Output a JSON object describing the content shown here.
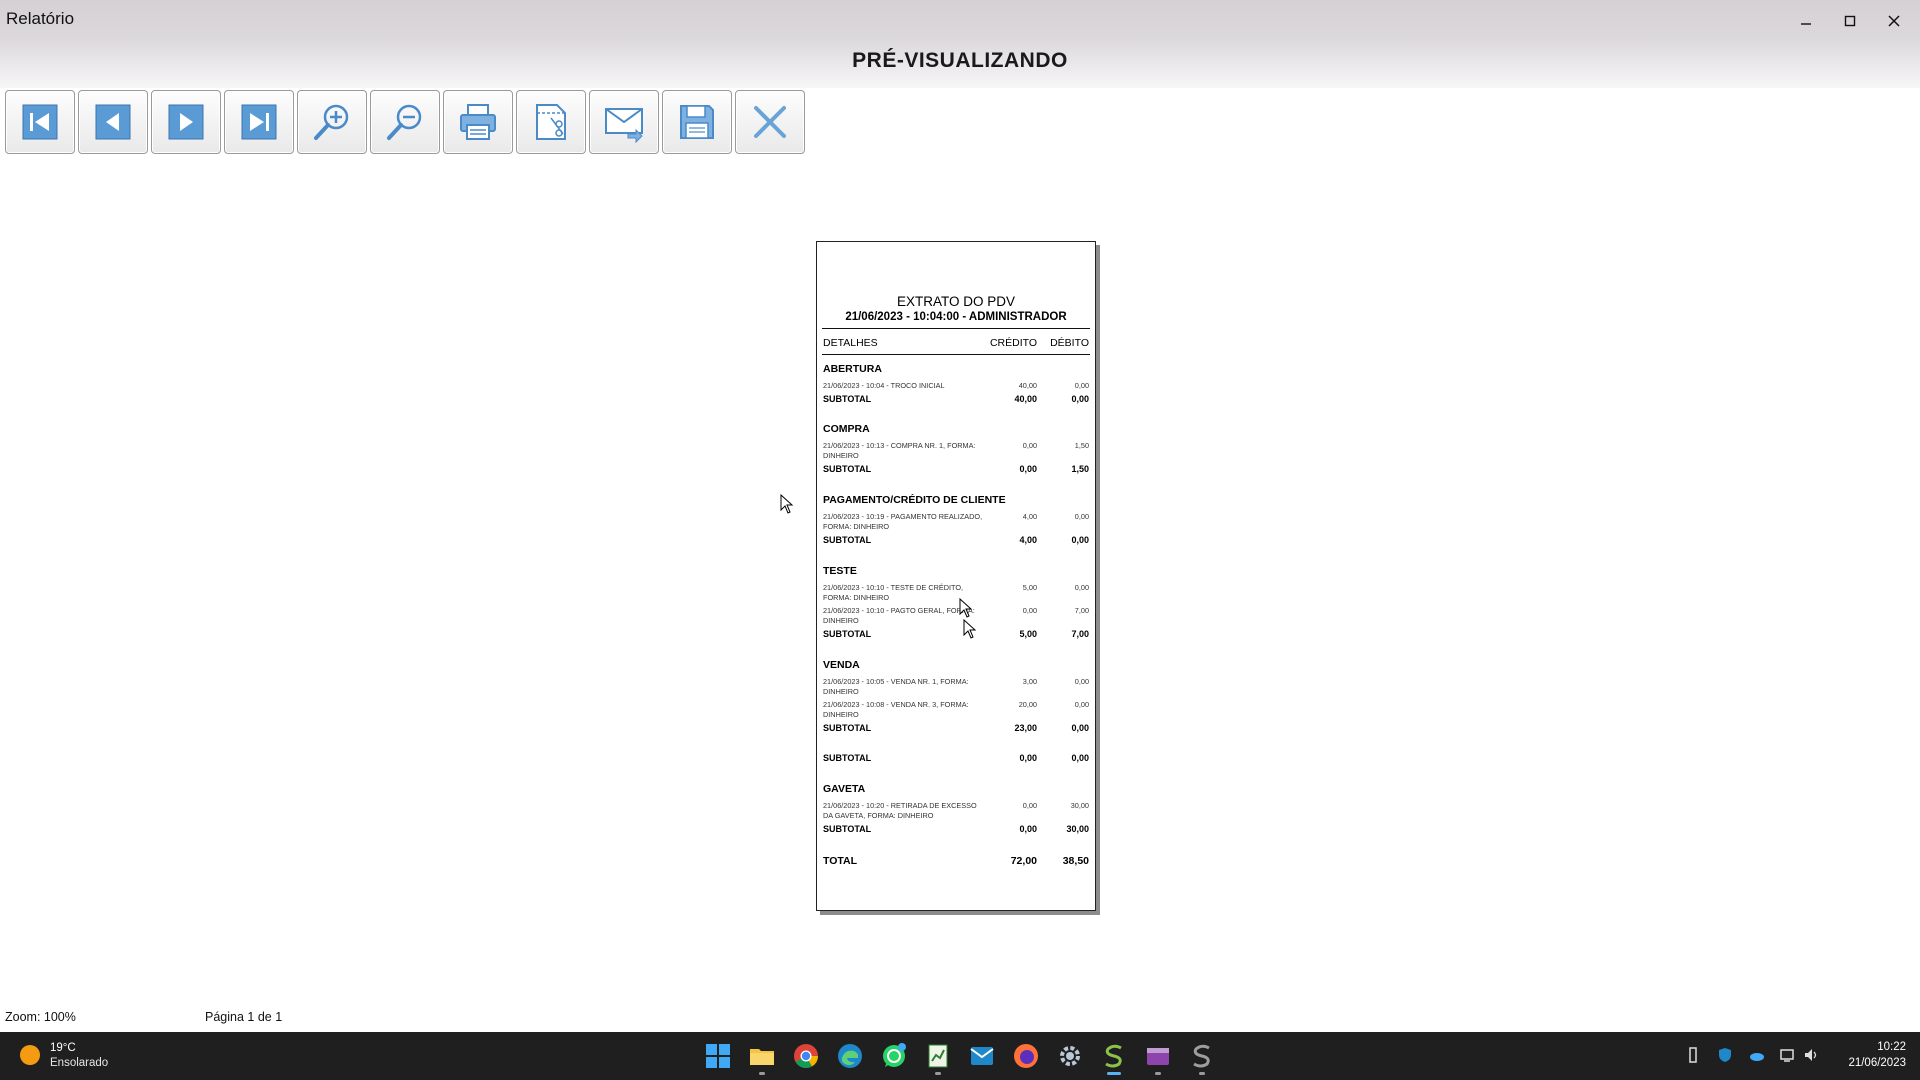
{
  "window": {
    "title": "Relatório",
    "header": "PRÉ-VISUALIZANDO"
  },
  "toolbar": {
    "buttons": [
      {
        "name": "first-page",
        "icon": "first-page-icon"
      },
      {
        "name": "previous-page",
        "icon": "previous-page-icon"
      },
      {
        "name": "next-page",
        "icon": "next-page-icon"
      },
      {
        "name": "last-page",
        "icon": "last-page-icon"
      },
      {
        "name": "zoom-in",
        "icon": "zoom-in-icon"
      },
      {
        "name": "zoom-out",
        "icon": "zoom-out-icon"
      },
      {
        "name": "print",
        "icon": "printer-icon"
      },
      {
        "name": "page-setup",
        "icon": "page-setup-icon"
      },
      {
        "name": "send-email",
        "icon": "email-icon"
      },
      {
        "name": "save",
        "icon": "save-icon"
      },
      {
        "name": "close",
        "icon": "close-icon"
      }
    ]
  },
  "report": {
    "title": "EXTRATO DO PDV",
    "subtitle": "21/06/2023 - 10:04:00 - ADMINISTRADOR",
    "columns": {
      "details": "DETALHES",
      "credit": "CRÉDITO",
      "debit": "DÉBITO"
    },
    "sections": [
      {
        "name": "ABERTURA",
        "entries": [
          {
            "desc": "21/06/2023 - 10:04 - TROCO INICIAL",
            "credit": "40,00",
            "debit": "0,00"
          }
        ],
        "subtotal": {
          "label": "SUBTOTAL",
          "credit": "40,00",
          "debit": "0,00"
        }
      },
      {
        "name": "COMPRA",
        "entries": [
          {
            "desc": "21/06/2023 - 10:13 - COMPRA NR. 1, FORMA: DINHEIRO",
            "credit": "0,00",
            "debit": "1,50"
          }
        ],
        "subtotal": {
          "label": "SUBTOTAL",
          "credit": "0,00",
          "debit": "1,50"
        }
      },
      {
        "name": "PAGAMENTO/CRÉDITO DE CLIENTE",
        "entries": [
          {
            "desc": "21/06/2023 - 10:19 - PAGAMENTO REALIZADO, FORMA: DINHEIRO",
            "credit": "4,00",
            "debit": "0,00"
          }
        ],
        "subtotal": {
          "label": "SUBTOTAL",
          "credit": "4,00",
          "debit": "0,00"
        }
      },
      {
        "name": "TESTE",
        "entries": [
          {
            "desc": "21/06/2023 - 10:10 - TESTE DE CRÉDITO, FORMA: DINHEIRO",
            "credit": "5,00",
            "debit": "0,00"
          },
          {
            "desc": "21/06/2023 - 10:10 - PAGTO GERAL, FORMA: DINHEIRO",
            "credit": "0,00",
            "debit": "7,00"
          }
        ],
        "subtotal": {
          "label": "SUBTOTAL",
          "credit": "5,00",
          "debit": "7,00"
        }
      },
      {
        "name": "VENDA",
        "entries": [
          {
            "desc": "21/06/2023 - 10:05 - VENDA NR. 1, FORMA: DINHEIRO",
            "credit": "3,00",
            "debit": "0,00"
          },
          {
            "desc": "21/06/2023 - 10:08 - VENDA NR. 3, FORMA: DINHEIRO",
            "credit": "20,00",
            "debit": "0,00"
          }
        ],
        "subtotal": {
          "label": "SUBTOTAL",
          "credit": "23,00",
          "debit": "0,00"
        }
      }
    ],
    "extra_subtotal": {
      "label": "SUBTOTAL",
      "credit": "0,00",
      "debit": "0,00"
    },
    "gaveta": {
      "name": "GAVETA",
      "entries": [
        {
          "desc": "21/06/2023 - 10:20 - RETIRADA DE EXCESSO DA GAVETA, FORMA: DINHEIRO",
          "credit": "0,00",
          "debit": "30,00"
        }
      ],
      "subtotal": {
        "label": "SUBTOTAL",
        "credit": "0,00",
        "debit": "30,00"
      }
    },
    "total": {
      "label": "TOTAL",
      "credit": "72,00",
      "debit": "38,50"
    }
  },
  "status": {
    "zoom": "Zoom: 100%",
    "page": "Página 1 de 1"
  },
  "taskbar": {
    "weather": {
      "temp": "19°C",
      "desc": "Ensolarado"
    },
    "apps": [
      "start-icon",
      "file-explorer-icon",
      "chrome-icon",
      "edge-icon",
      "whatsapp-icon",
      "spreadsheet-icon",
      "mail-icon",
      "firefox-icon",
      "settings-icon",
      "app-s-icon",
      "video-icon",
      "app-s2-icon"
    ],
    "clock": {
      "time": "10:22",
      "date": "21/06/2023"
    }
  },
  "colors": {
    "toolbar_icon_blue": "#5b9bd5",
    "titlebar_top": "#d4d0d4",
    "taskbar_bg": "#1f1f1f"
  }
}
